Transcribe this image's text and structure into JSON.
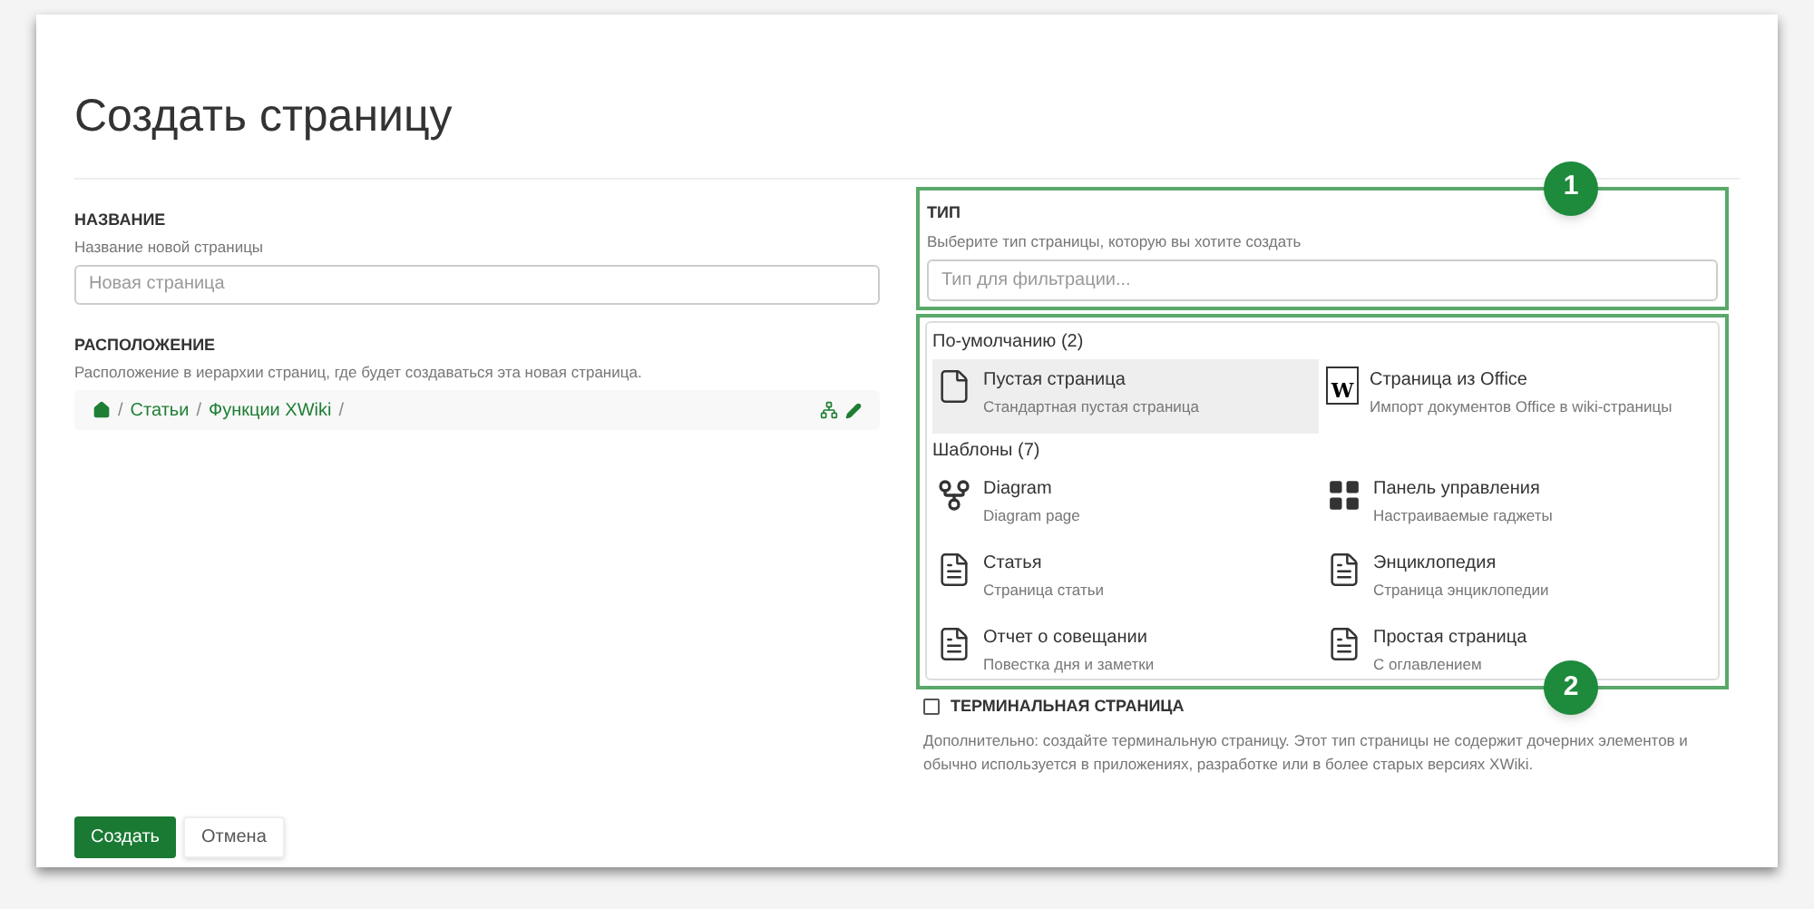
{
  "title": "Создать страницу",
  "name_field": {
    "label": "НАЗВАНИЕ",
    "hint": "Название новой страницы",
    "placeholder": "Новая страница"
  },
  "location": {
    "label": "РАСПОЛОЖЕНИЕ",
    "hint": "Расположение в иерархии страниц, где будет создаваться эта новая страница.",
    "breadcrumb": [
      "Статьи",
      "Функции XWiki"
    ],
    "separator": "/"
  },
  "type": {
    "label": "ТИП",
    "hint": "Выберите тип страницы, которую вы хотите создать",
    "placeholder": "Тип для фильтрации...",
    "groups": [
      {
        "title": "По-умолчанию (2)",
        "items": [
          {
            "kind": "blank",
            "name": "Пустая страница",
            "description": "Стандартная пустая страница",
            "selected": true
          },
          {
            "kind": "office",
            "icon_letter": "W",
            "name": "Страница из Office",
            "description": "Импорт документов Office в wiki-страницы",
            "selected": false
          }
        ]
      },
      {
        "title": "Шаблоны (7)",
        "items": [
          {
            "kind": "diagram",
            "name": "Diagram",
            "description": "Diagram page",
            "selected": false
          },
          {
            "kind": "dashboard",
            "name": "Панель управления",
            "description": "Настраиваемые гаджеты",
            "selected": false
          },
          {
            "kind": "document",
            "name": "Статья",
            "description": "Страница статьи",
            "selected": false
          },
          {
            "kind": "document",
            "name": "Энциклопедия",
            "description": "Страница энциклопедии",
            "selected": false
          },
          {
            "kind": "document",
            "name": "Отчет о совещании",
            "description": "Повестка дня и заметки",
            "selected": false
          },
          {
            "kind": "document",
            "name": "Простая страница",
            "description": "С оглавлением",
            "selected": false
          }
        ]
      }
    ]
  },
  "terminal": {
    "label": "ТЕРМИНАЛЬНАЯ СТРАНИЦА",
    "checked": false,
    "hint": "Дополнительно: создайте терминальную страницу. Этот тип страницы не содержит дочерних элементов и обычно используется в приложениях, разработке или в более старых версиях XWiki."
  },
  "buttons": [
    {
      "kind": "primary",
      "label": "Создать"
    },
    {
      "kind": "secondary",
      "label": "Отмена"
    }
  ],
  "callouts": [
    "1",
    "2"
  ]
}
